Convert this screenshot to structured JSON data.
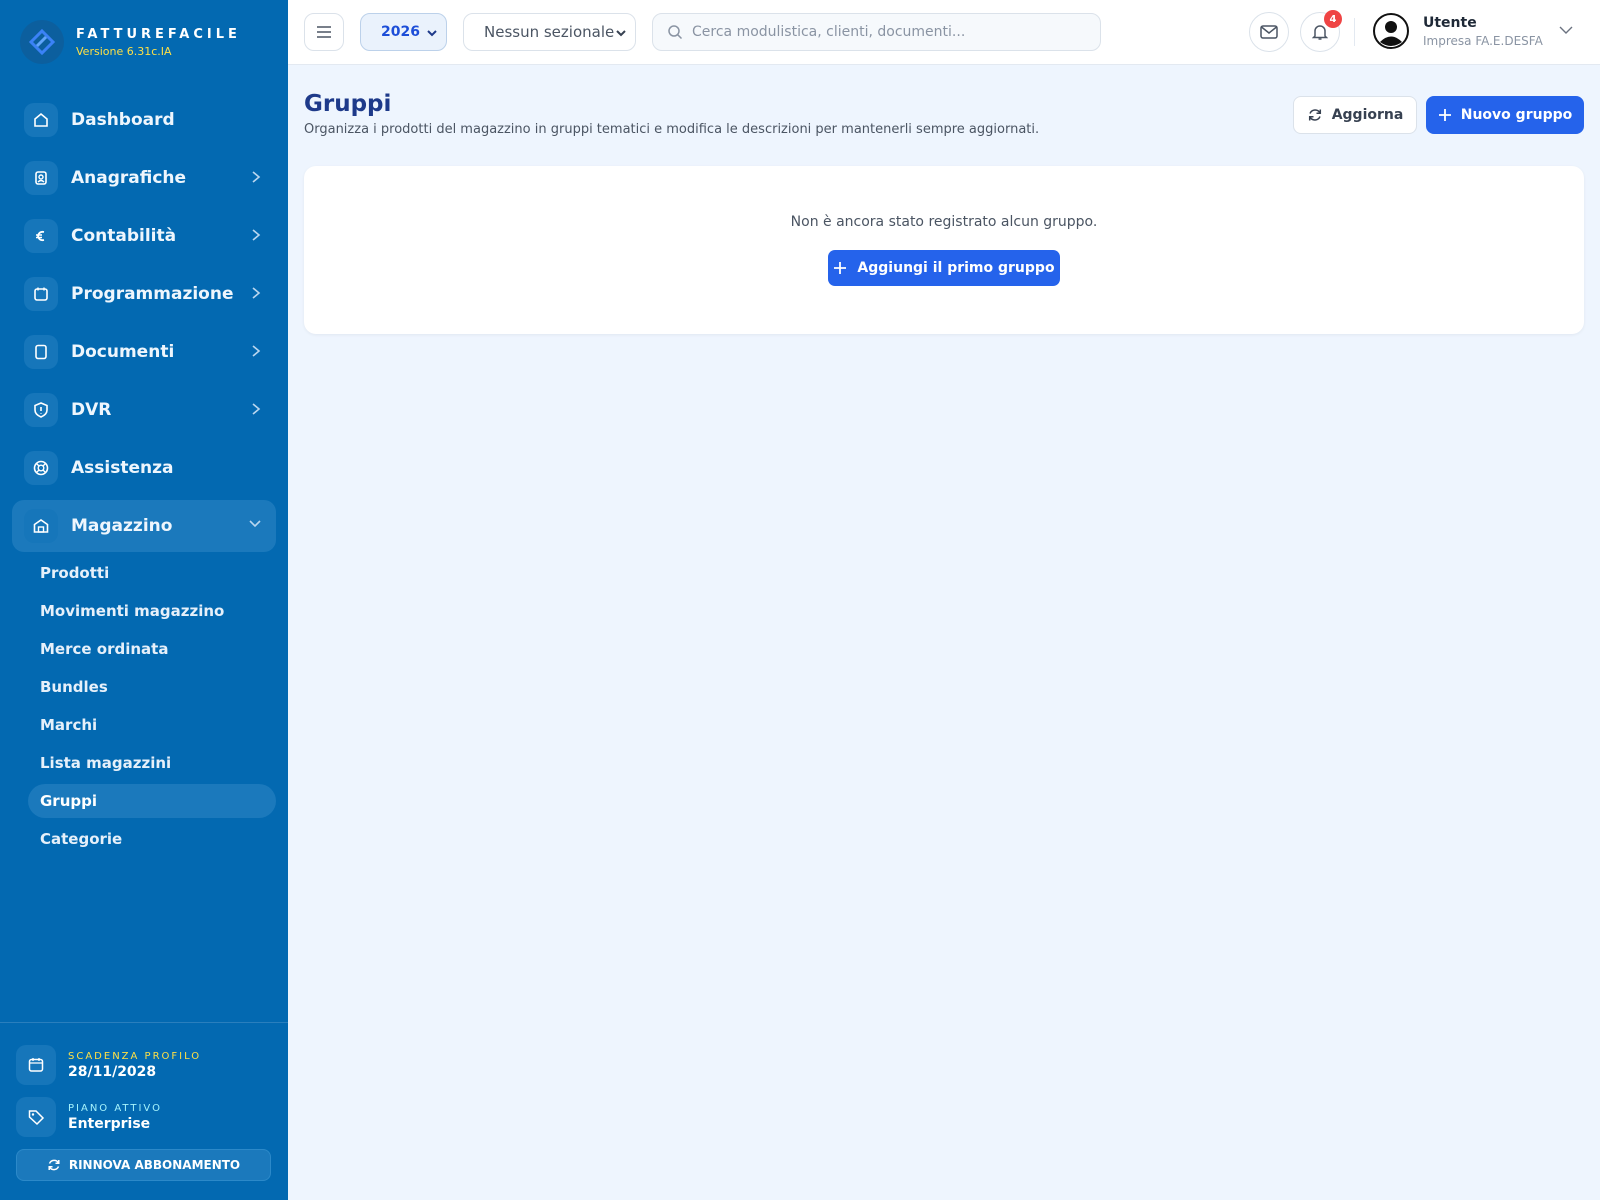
{
  "brand": {
    "name": "FATTUREFACILE",
    "version": "Versione 6.31c.IA"
  },
  "sidebar": {
    "items": [
      {
        "label": "Dashboard",
        "icon": "home-icon",
        "has_chevron": false
      },
      {
        "label": "Anagrafiche",
        "icon": "contact-icon",
        "has_chevron": true
      },
      {
        "label": "Contabilità",
        "icon": "euro-icon",
        "has_chevron": true
      },
      {
        "label": "Programmazione",
        "icon": "calendar-icon",
        "has_chevron": true
      },
      {
        "label": "Documenti",
        "icon": "document-icon",
        "has_chevron": true
      },
      {
        "label": "DVR",
        "icon": "shield-icon",
        "has_chevron": true
      },
      {
        "label": "Assistenza",
        "icon": "lifebuoy-icon",
        "has_chevron": false
      },
      {
        "label": "Magazzino",
        "icon": "warehouse-icon",
        "has_chevron": true,
        "expanded": true,
        "active": true
      }
    ],
    "sub_items": [
      {
        "label": "Prodotti"
      },
      {
        "label": "Movimenti magazzino"
      },
      {
        "label": "Merce ordinata"
      },
      {
        "label": "Bundles"
      },
      {
        "label": "Marchi"
      },
      {
        "label": "Lista magazzini"
      },
      {
        "label": "Gruppi",
        "active": true
      },
      {
        "label": "Categorie"
      }
    ],
    "footer": {
      "expiry_caption": "SCADENZA PROFILO",
      "expiry_value": "28/11/2028",
      "plan_caption": "PIANO ATTIVO",
      "plan_value": "Enterprise",
      "renew_label": "RINNOVA ABBONAMENTO"
    }
  },
  "topbar": {
    "year": "2026",
    "sezionale": "Nessun sezionale",
    "search_placeholder": "Cerca modulistica, clienti, documenti...",
    "notification_count": "4",
    "user_name": "Utente",
    "user_company": "Impresa FA.E.DESFA"
  },
  "main": {
    "title": "Gruppi",
    "subtitle": "Organizza i prodotti del magazzino in gruppi tematici e modifica le descrizioni per mantenerli sempre aggiornati.",
    "refresh_label": "Aggiorna",
    "new_label": "Nuovo gruppo",
    "empty_text": "Non è ancora stato registrato alcun gruppo.",
    "add_first_label": "Aggiungi il primo gruppo"
  },
  "colors": {
    "sidebar_bg": "#0369b1",
    "accent": "#2563eb",
    "title": "#1e3a8a",
    "page_bg": "#eef5fe",
    "version_yellow": "#fde047",
    "badge_red": "#ef4444"
  }
}
